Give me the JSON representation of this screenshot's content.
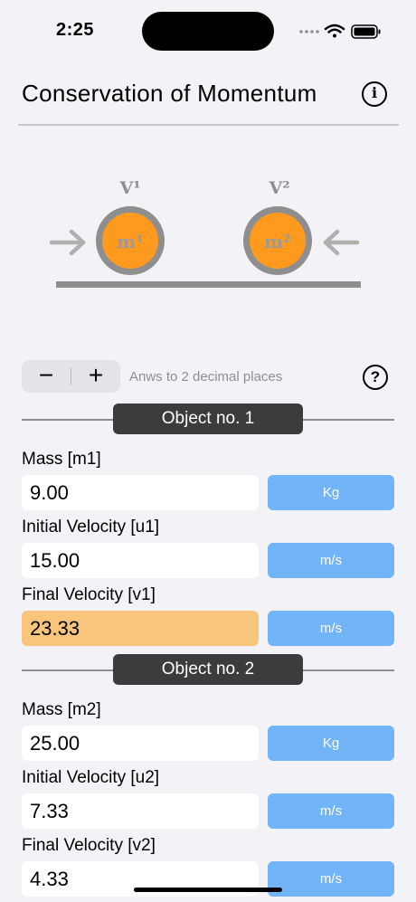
{
  "status_bar": {
    "time": "2:25"
  },
  "header": {
    "title": "Conservation of Momentum",
    "info_icon": "i"
  },
  "diagram": {
    "v1_label": "V¹",
    "v2_label": "V²",
    "m1_label": "m¹",
    "m2_label": "m²",
    "colors": {
      "ring": "#8e8e8e",
      "mass": "#ff9a1f",
      "arrow": "#b0b0b0",
      "ground": "#8e8e8e"
    }
  },
  "controls": {
    "minus_label": "−",
    "plus_label": "+",
    "precision_text": "Anws to 2 decimal places",
    "help_icon": "?"
  },
  "objects": [
    {
      "title": "Object no. 1",
      "mass_label": "Mass [m1]",
      "mass_value": "9.00",
      "mass_unit": "Kg",
      "initial_label": "Initial Velocity [u1]",
      "initial_value": "15.00",
      "initial_unit": "m/s",
      "final_label": "Final Velocity [v1]",
      "final_value": "23.33",
      "final_unit": "m/s"
    },
    {
      "title": "Object no. 2",
      "mass_label": "Mass [m2]",
      "mass_value": "25.00",
      "mass_unit": "Kg",
      "initial_label": "Initial Velocity [u2]",
      "initial_value": "7.33",
      "initial_unit": "m/s",
      "final_label": "Final Velocity [v2]",
      "final_value": "4.33",
      "final_unit": "m/s"
    }
  ],
  "colors": {
    "background": "#f2f2f7",
    "unit_button": "#72b4f8",
    "result_field": "#f8c57c",
    "section_badge": "#3c3c3e"
  }
}
